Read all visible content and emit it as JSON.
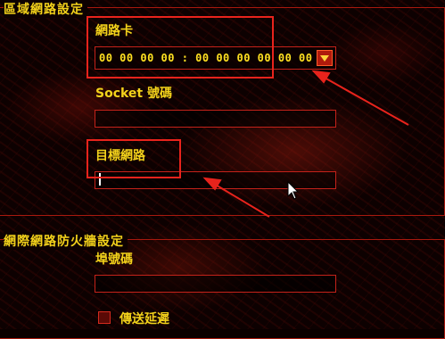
{
  "lan": {
    "section_title": "區域網路設定",
    "nic_label": "網路卡",
    "nic_value": "00 00 00 00 : 00 00 00 00 00 00",
    "socket_label": "Socket 號碼",
    "socket_value": "",
    "target_label": "目標網路",
    "target_value": ""
  },
  "internet": {
    "section_title": "網際網路防火牆設定",
    "port_label": "埠號碼",
    "port_value": "",
    "delay_label": "傳送延遲",
    "delay_checked": false
  },
  "icons": {
    "dropdown": "chevron-down-icon",
    "cursor": "mouse-pointer-icon",
    "annotation": "red-arrow-icon"
  },
  "colors": {
    "text": "#f3d21b",
    "frame": "#a8190e",
    "highlight": "#e8231c",
    "background": "#0d0101"
  }
}
